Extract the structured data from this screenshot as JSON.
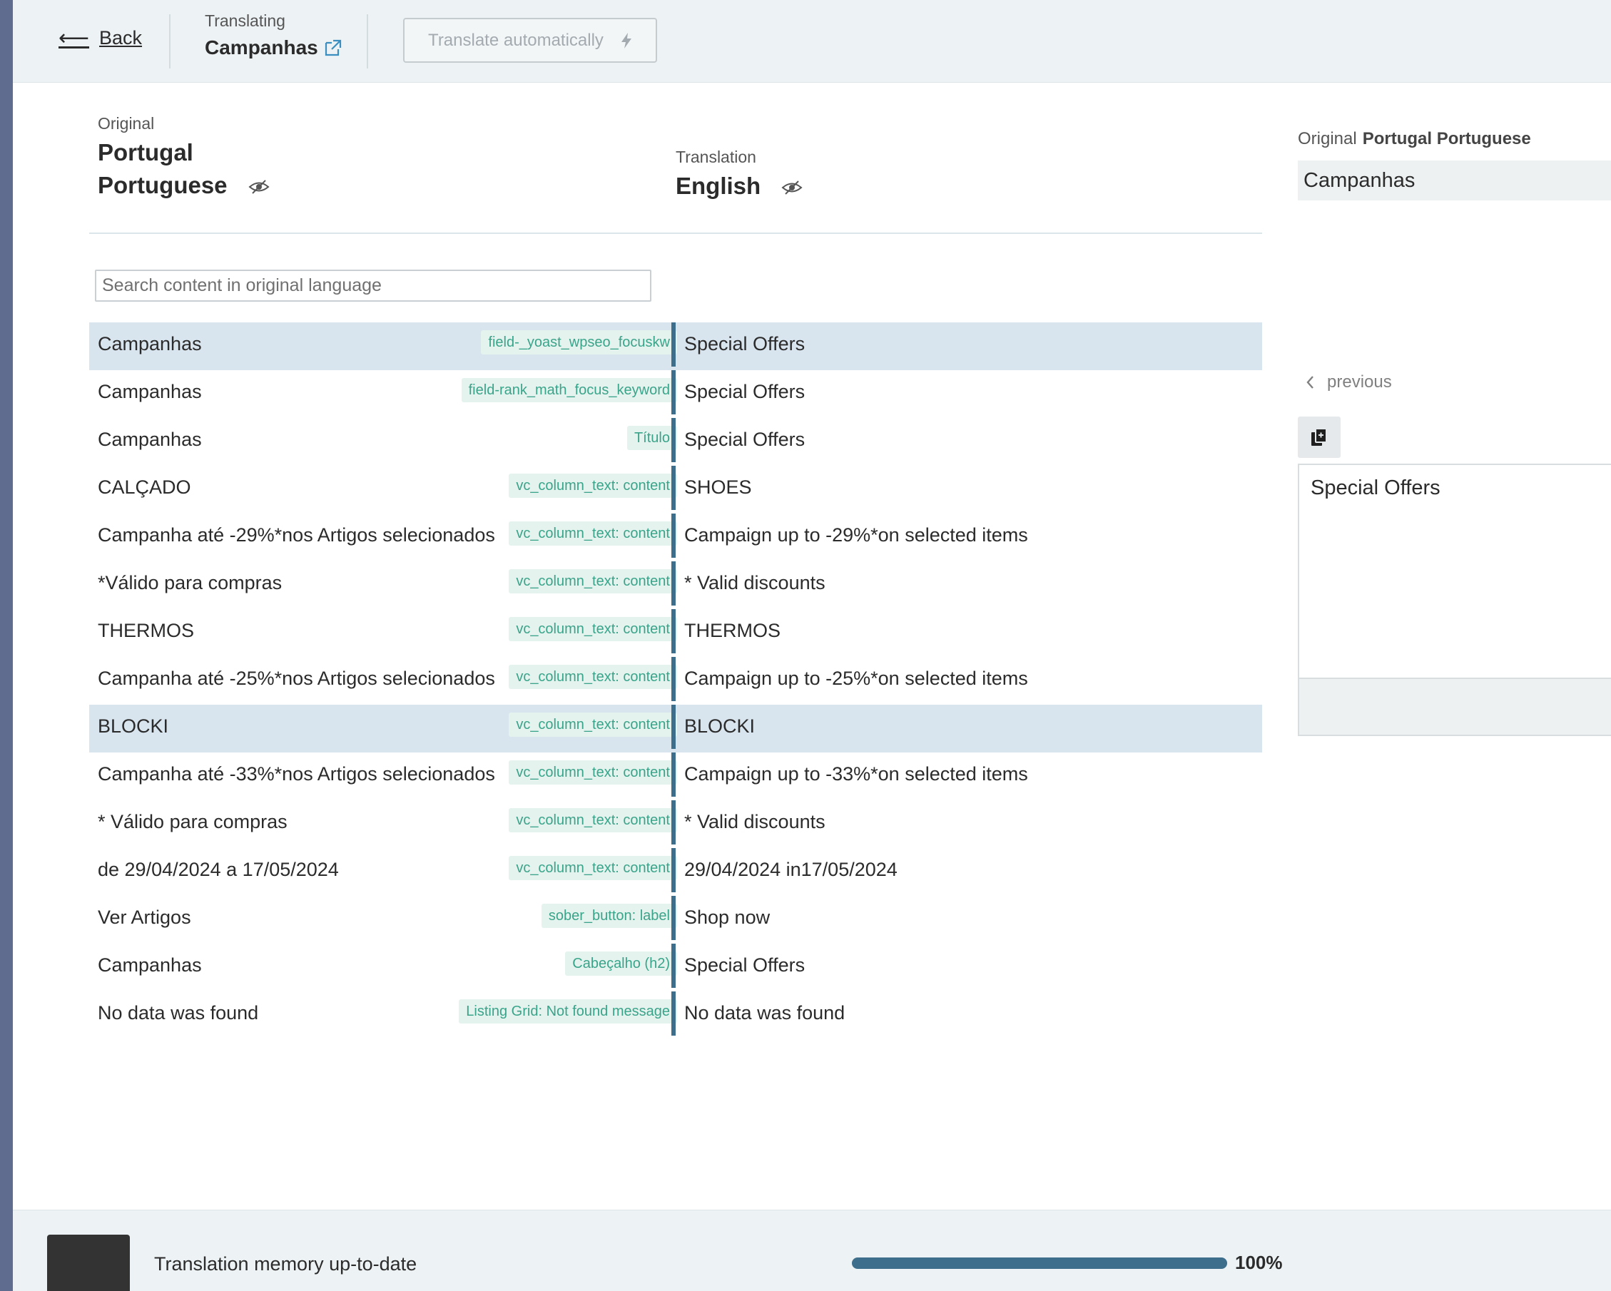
{
  "header": {
    "back_label": "Back",
    "translating_label": "Translating",
    "page_title": "Campanhas",
    "translate_auto_label": "Translate automatically"
  },
  "languages": {
    "original_label": "Original",
    "original_line1": "Portugal",
    "original_line2": "Portuguese",
    "translation_label": "Translation",
    "translation_name": "English"
  },
  "search": {
    "placeholder": "Search content in original language"
  },
  "rows": [
    {
      "original": "Campanhas",
      "tag": "field-_yoast_wpseo_focuskw",
      "translation": "Special Offers",
      "selected": true
    },
    {
      "original": "Campanhas",
      "tag": "field-rank_math_focus_keyword",
      "translation": "Special Offers",
      "selected": false
    },
    {
      "original": "Campanhas",
      "tag": "Título",
      "translation": "Special Offers",
      "selected": false
    },
    {
      "original": "CALÇADO",
      "tag": "vc_column_text: content",
      "translation": "SHOES",
      "selected": false
    },
    {
      "original": "Campanha até -29%*nos Artigos selecionados",
      "tag": "vc_column_text: content",
      "translation": "Campaign up to -29%*on selected items",
      "selected": false
    },
    {
      "original": "*Válido para compras",
      "tag": "vc_column_text: content",
      "translation": "* Valid discounts",
      "selected": false
    },
    {
      "original": "THERMOS",
      "tag": "vc_column_text: content",
      "translation": "THERMOS",
      "selected": false
    },
    {
      "original": "Campanha até -25%*nos Artigos selecionados",
      "tag": "vc_column_text: content",
      "translation": "Campaign up to -25%*on selected items",
      "selected": false
    },
    {
      "original": "BLOCKI",
      "tag": "vc_column_text: content",
      "translation": "BLOCKI",
      "selected": true
    },
    {
      "original": "Campanha até -33%*nos Artigos selecionados",
      "tag": "vc_column_text: content",
      "translation": "Campaign up to -33%*on selected items",
      "selected": false
    },
    {
      "original": "* Válido para compras",
      "tag": "vc_column_text: content",
      "translation": "* Valid discounts",
      "selected": false
    },
    {
      "original": "de 29/04/2024 a 17/05/2024",
      "tag": "vc_column_text: content",
      "translation": "29/04/2024 in17/05/2024",
      "selected": false
    },
    {
      "original": "Ver Artigos",
      "tag": "sober_button: label",
      "translation": "Shop now",
      "selected": false
    },
    {
      "original": "Campanhas",
      "tag": "Cabeçalho (h2)",
      "translation": "Special Offers",
      "selected": false
    },
    {
      "original": "No data was found",
      "tag": "Listing Grid: Not found message",
      "translation": "No data was found",
      "selected": false
    }
  ],
  "right_panel": {
    "original_label": "Original",
    "original_language": "Portugal Portuguese",
    "source_text": "Campanhas",
    "previous_label": "previous",
    "translation_text": "Special Offers"
  },
  "footer": {
    "status_text": "Translation memory up-to-date",
    "progress_label": "100%",
    "progress_value": 1.0
  },
  "colors": {
    "accent": "#3d6e8c",
    "tag_text": "#3aa48a",
    "tag_bg": "#e4f3ee",
    "selected_row": "#d8e4ee"
  }
}
